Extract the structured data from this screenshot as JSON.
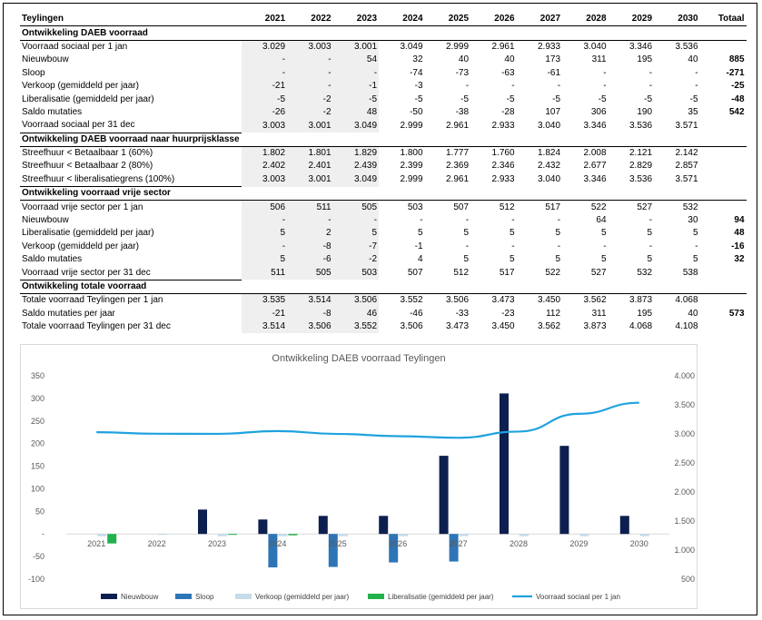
{
  "table": {
    "header": {
      "label": "Teylingen",
      "years": [
        "2021",
        "2022",
        "2023",
        "2024",
        "2025",
        "2026",
        "2027",
        "2028",
        "2029",
        "2030"
      ],
      "total": "Totaal"
    },
    "sections": [
      {
        "title": "Ontwikkeling DAEB voorraad",
        "rows": [
          {
            "label": "Voorraad sociaal per 1 jan",
            "values": [
              "3.029",
              "3.003",
              "3.001",
              "3.049",
              "2.999",
              "2.961",
              "2.933",
              "3.040",
              "3.346",
              "3.536"
            ],
            "total": ""
          },
          {
            "label": "Nieuwbouw",
            "values": [
              "-",
              "-",
              "54",
              "32",
              "40",
              "40",
              "173",
              "311",
              "195",
              "40"
            ],
            "total": "885"
          },
          {
            "label": "Sloop",
            "values": [
              "-",
              "-",
              "-",
              "-74",
              "-73",
              "-63",
              "-61",
              "-",
              "-",
              "-"
            ],
            "total": "-271"
          },
          {
            "label": "Verkoop (gemiddeld per jaar)",
            "values": [
              "-21",
              "-",
              "-1",
              "-3",
              "-",
              "-",
              "-",
              "-",
              "-",
              "-"
            ],
            "total": "-25"
          },
          {
            "label": "Liberalisatie (gemiddeld per jaar)",
            "values": [
              "-5",
              "-2",
              "-5",
              "-5",
              "-5",
              "-5",
              "-5",
              "-5",
              "-5",
              "-5"
            ],
            "total": "-48"
          },
          {
            "label": "Saldo mutaties",
            "values": [
              "-26",
              "-2",
              "48",
              "-50",
              "-38",
              "-28",
              "107",
              "306",
              "190",
              "35"
            ],
            "total": "542"
          },
          {
            "label": "Voorraad sociaal per 31 dec",
            "values": [
              "3.003",
              "3.001",
              "3.049",
              "2.999",
              "2.961",
              "2.933",
              "3.040",
              "3.346",
              "3.536",
              "3.571"
            ],
            "total": ""
          }
        ]
      },
      {
        "title": "Ontwikkeling DAEB voorraad naar huurprijsklasse",
        "rows": [
          {
            "label": "Streefhuur < Betaalbaar 1 (60%)",
            "values": [
              "1.802",
              "1.801",
              "1.829",
              "1.800",
              "1.777",
              "1.760",
              "1.824",
              "2.008",
              "2.121",
              "2.142"
            ],
            "total": ""
          },
          {
            "label": "Streefhuur < Betaalbaar 2 (80%)",
            "values": [
              "2.402",
              "2.401",
              "2.439",
              "2.399",
              "2.369",
              "2.346",
              "2.432",
              "2.677",
              "2.829",
              "2.857"
            ],
            "total": ""
          },
          {
            "label": "Streefhuur < liberalisatiegrens (100%)",
            "values": [
              "3.003",
              "3.001",
              "3.049",
              "2.999",
              "2.961",
              "2.933",
              "3.040",
              "3.346",
              "3.536",
              "3.571"
            ],
            "total": ""
          }
        ]
      },
      {
        "title": "Ontwikkeling voorraad vrije sector",
        "rows": [
          {
            "label": "Voorraad vrije sector per 1 jan",
            "values": [
              "506",
              "511",
              "505",
              "503",
              "507",
              "512",
              "517",
              "522",
              "527",
              "532"
            ],
            "total": ""
          },
          {
            "label": "Nieuwbouw",
            "values": [
              "-",
              "-",
              "-",
              "-",
              "-",
              "-",
              "-",
              "64",
              "-",
              "30"
            ],
            "total": "94"
          },
          {
            "label": "Liberalisatie (gemiddeld per jaar)",
            "values": [
              "5",
              "2",
              "5",
              "5",
              "5",
              "5",
              "5",
              "5",
              "5",
              "5"
            ],
            "total": "48"
          },
          {
            "label": "Verkoop (gemiddeld per jaar)",
            "values": [
              "-",
              "-8",
              "-7",
              "-1",
              "-",
              "-",
              "-",
              "-",
              "-",
              "-"
            ],
            "total": "-16"
          },
          {
            "label": "Saldo mutaties",
            "values": [
              "5",
              "-6",
              "-2",
              "4",
              "5",
              "5",
              "5",
              "5",
              "5",
              "5"
            ],
            "total": "32"
          },
          {
            "label": "Voorraad vrije sector per 31 dec",
            "values": [
              "511",
              "505",
              "503",
              "507",
              "512",
              "517",
              "522",
              "527",
              "532",
              "538"
            ],
            "total": ""
          }
        ]
      },
      {
        "title": "Ontwikkeling totale voorraad",
        "rows": [
          {
            "label": "Totale voorraad Teylingen per 1 jan",
            "values": [
              "3.535",
              "3.514",
              "3.506",
              "3.552",
              "3.506",
              "3.473",
              "3.450",
              "3.562",
              "3.873",
              "4.068"
            ],
            "total": ""
          },
          {
            "label": "Saldo mutaties per jaar",
            "values": [
              "-21",
              "-8",
              "46",
              "-46",
              "-33",
              "-23",
              "112",
              "311",
              "195",
              "40"
            ],
            "total": "573"
          },
          {
            "label": "Totale voorraad Teylingen per 31 dec",
            "values": [
              "3.514",
              "3.506",
              "3.552",
              "3.506",
              "3.473",
              "3.450",
              "3.562",
              "3.873",
              "4.068",
              "4.108"
            ],
            "total": ""
          }
        ]
      }
    ]
  },
  "chart_data": {
    "type": "bar",
    "title": "Ontwikkeling DAEB voorraad Teylingen",
    "categories": [
      "2021",
      "2022",
      "2023",
      "2024",
      "2025",
      "2026",
      "2027",
      "2028",
      "2029",
      "2030"
    ],
    "series": [
      {
        "name": "Nieuwbouw",
        "type": "bar",
        "axis": "left",
        "color": "#0d1f4f",
        "values": [
          0,
          0,
          54,
          32,
          40,
          40,
          173,
          311,
          195,
          40
        ]
      },
      {
        "name": "Sloop",
        "type": "bar",
        "axis": "left",
        "color": "#2e75b6",
        "values": [
          0,
          0,
          0,
          -74,
          -73,
          -63,
          -61,
          0,
          0,
          0
        ]
      },
      {
        "name": "Verkoop (gemiddeld per jaar)",
        "type": "bar",
        "axis": "left",
        "color": "#c5dce9",
        "values": [
          -5,
          -2,
          -5,
          -5,
          -5,
          -5,
          -5,
          -5,
          -5,
          -5
        ]
      },
      {
        "name": "Liberalisatie (gemiddeld per jaar)",
        "type": "bar",
        "axis": "left",
        "color": "#22b14c",
        "values": [
          -21,
          0,
          -1,
          -3,
          0,
          0,
          0,
          0,
          0,
          0
        ]
      },
      {
        "name": "Voorraad sociaal per 1 jan",
        "type": "line",
        "axis": "right",
        "color": "#1fa2de",
        "values": [
          3029,
          3003,
          3001,
          3049,
          2999,
          2961,
          2933,
          3040,
          3346,
          3536
        ]
      }
    ],
    "ylim": [
      -100,
      350
    ],
    "y_ticks": [
      350,
      300,
      250,
      200,
      150,
      100,
      50,
      0,
      -50,
      -100
    ],
    "y_tick_labels": [
      "350",
      "300",
      "250",
      "200",
      "150",
      "100",
      "50",
      "-",
      "-50",
      "-100"
    ],
    "y2lim": [
      500,
      4000
    ],
    "y2_ticks": [
      4000,
      3500,
      3000,
      2500,
      2000,
      1500,
      1000,
      500
    ],
    "y2_tick_labels": [
      "4.000",
      "3.500",
      "3.000",
      "2.500",
      "2.000",
      "1.500",
      "1.000",
      "500",
      "-"
    ],
    "grid": false,
    "legend_position": "bottom"
  }
}
